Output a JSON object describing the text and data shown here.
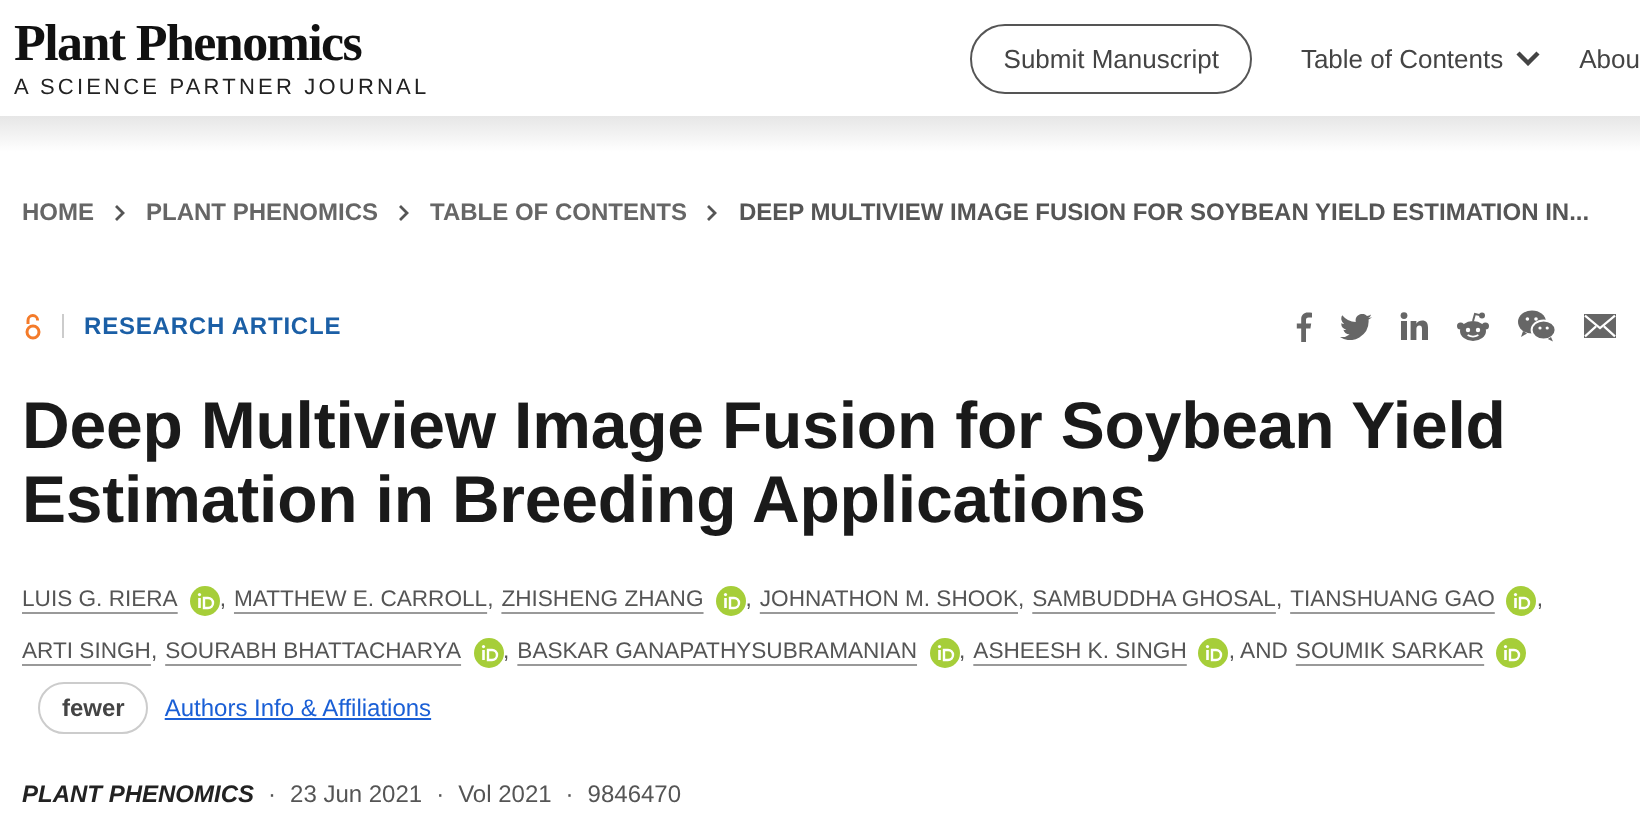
{
  "header": {
    "logo_title": "Plant Phenomics",
    "logo_subtitle": "A SCIENCE PARTNER JOURNAL",
    "submit_button": "Submit Manuscript",
    "nav": [
      {
        "label": "Table of Contents",
        "dropdown": true
      },
      {
        "label": "Abou",
        "dropdown": false
      }
    ]
  },
  "breadcrumb": [
    "HOME",
    "PLANT PHENOMICS",
    "TABLE OF CONTENTS",
    "DEEP MULTIVIEW IMAGE FUSION FOR SOYBEAN YIELD ESTIMATION IN..."
  ],
  "article_type": "RESEARCH ARTICLE",
  "open_access": true,
  "share_buttons": [
    {
      "kind": "facebook"
    },
    {
      "kind": "twitter"
    },
    {
      "kind": "linkedin"
    },
    {
      "kind": "reddit"
    },
    {
      "kind": "wechat"
    },
    {
      "kind": "email"
    }
  ],
  "title": "Deep Multiview Image Fusion for Soybean Yield Estimation in Breeding Applications",
  "author_rows": [
    [
      {
        "name": "LUIS G. RIERA",
        "orcid": true,
        "after": ","
      },
      {
        "name": "MATTHEW E. CARROLL",
        "orcid": false,
        "after": ","
      },
      {
        "name": "ZHISHENG ZHANG",
        "orcid": true,
        "after": ","
      },
      {
        "name": "JOHNATHON M. SHOOK",
        "orcid": false,
        "after": ","
      },
      {
        "name": "SAMBUDDHA GHOSAL",
        "orcid": false,
        "after": ","
      },
      {
        "name": "TIANSHUANG GAO",
        "orcid": true,
        "after": ","
      }
    ],
    [
      {
        "name": "ARTI SINGH",
        "orcid": false,
        "after": ","
      },
      {
        "name": "SOURABH BHATTACHARYA",
        "orcid": true,
        "after": ","
      },
      {
        "name": "BASKAR GANAPATHYSUBRAMANIAN",
        "orcid": true,
        "after": ","
      },
      {
        "name": "ASHEESH K. SINGH",
        "orcid": true,
        "after": ", AND"
      },
      {
        "name": "SOUMIK SARKAR",
        "orcid": true
      }
    ]
  ],
  "fewer_button": "fewer",
  "affiliations_link": "Authors Info & Affiliations",
  "meta": {
    "journal": "PLANT PHENOMICS",
    "date": "23 Jun 2021",
    "volume": "Vol 2021",
    "article_number": "9846470",
    "separator": "·"
  }
}
